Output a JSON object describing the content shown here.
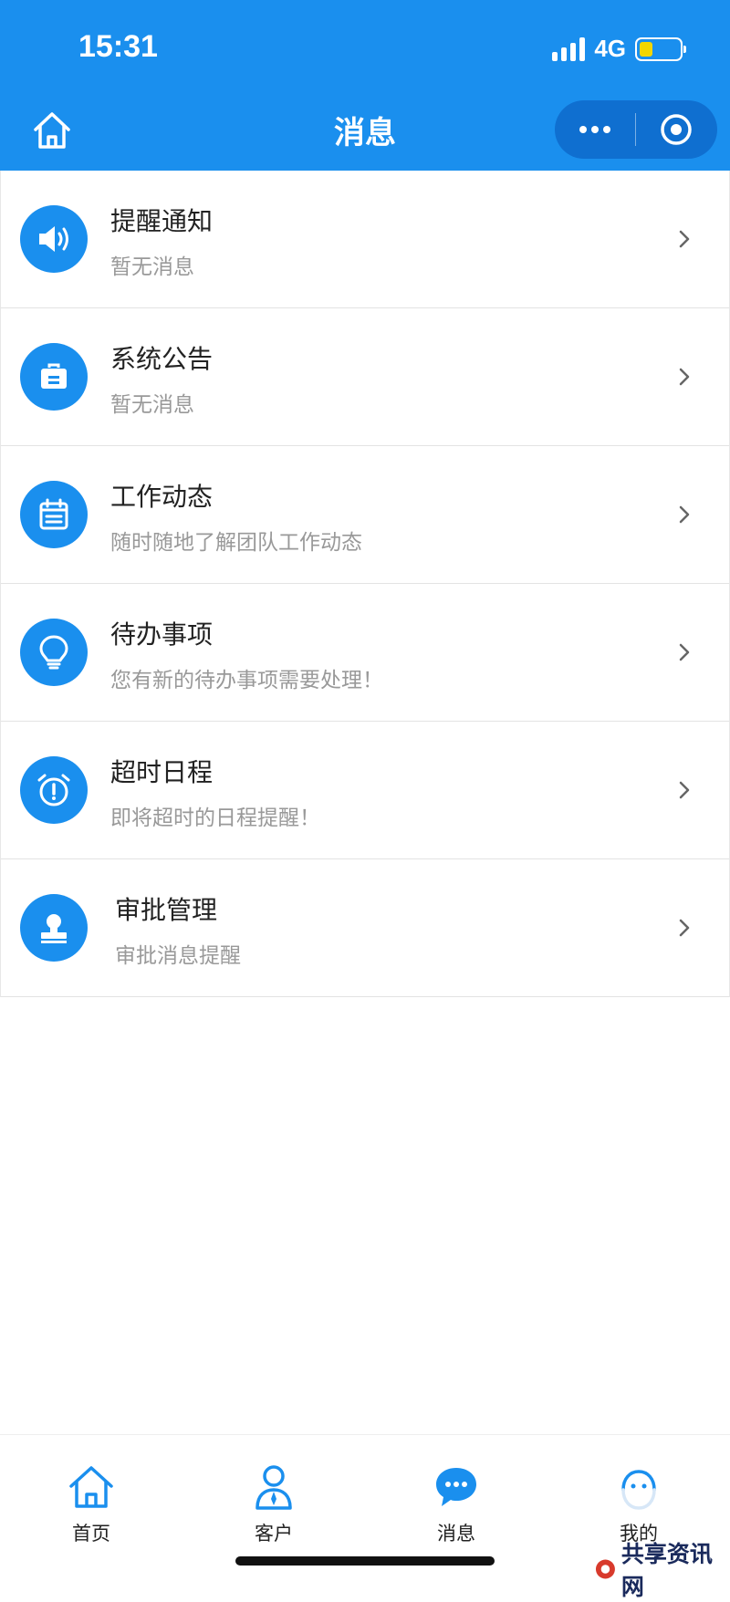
{
  "status_bar": {
    "time": "15:31",
    "network": "4G"
  },
  "header": {
    "title": "消息"
  },
  "messages": [
    {
      "title": "提醒通知",
      "subtitle": "暂无消息",
      "icon": "speaker-icon"
    },
    {
      "title": "系统公告",
      "subtitle": "暂无消息",
      "icon": "briefcase-icon"
    },
    {
      "title": "工作动态",
      "subtitle": "随时随地了解团队工作动态",
      "icon": "calendar-icon"
    },
    {
      "title": "待办事项",
      "subtitle": "您有新的待办事项需要处理！",
      "icon": "lightbulb-icon"
    },
    {
      "title": "超时日程",
      "subtitle": "即将超时的日程提醒！",
      "icon": "alarm-clock-icon"
    },
    {
      "title": "审批管理",
      "subtitle": "审批消息提醒",
      "icon": "stamp-icon"
    }
  ],
  "tabbar": {
    "items": [
      {
        "label": "首页",
        "icon": "home-icon"
      },
      {
        "label": "客户",
        "icon": "person-icon"
      },
      {
        "label": "消息",
        "icon": "chat-bubble-icon",
        "active": true
      },
      {
        "label": "我的",
        "icon": "profile-icon"
      }
    ]
  },
  "watermark": {
    "text": "共享资讯网"
  },
  "colors": {
    "accent": "#1a8fee",
    "battery": "#f2d600"
  }
}
